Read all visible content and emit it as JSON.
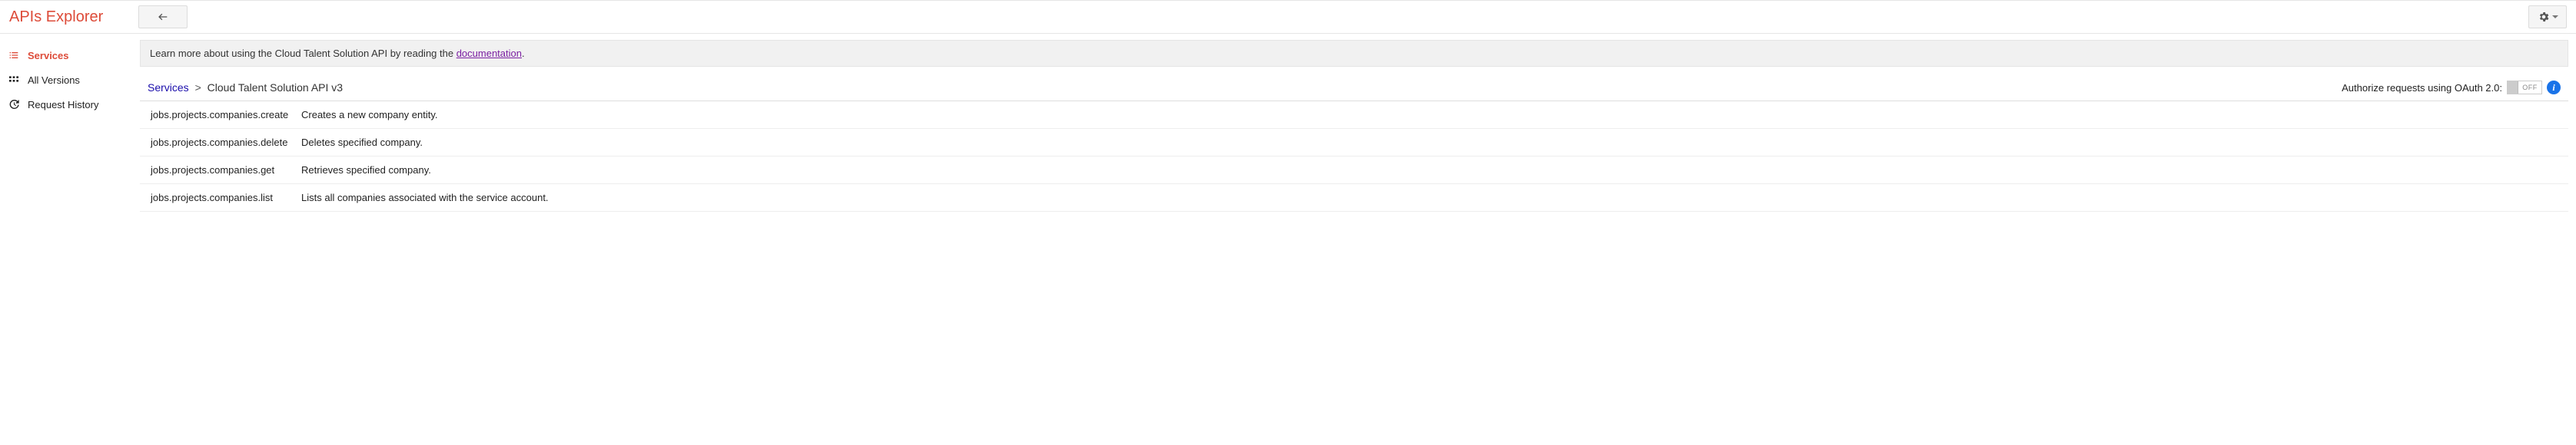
{
  "header": {
    "brand": "APIs Explorer"
  },
  "sidebar": {
    "items": [
      {
        "label": "Services"
      },
      {
        "label": "All Versions"
      },
      {
        "label": "Request History"
      }
    ]
  },
  "banner": {
    "prefix": "Learn more about using the Cloud Talent Solution API by reading the ",
    "link": "documentation",
    "suffix": "."
  },
  "breadcrumb": {
    "root": "Services",
    "sep": ">",
    "current": "Cloud Talent Solution API v3"
  },
  "auth": {
    "label": "Authorize requests using OAuth 2.0:",
    "toggle": "OFF"
  },
  "methods": [
    {
      "name": "jobs.projects.companies.create",
      "desc": "Creates a new company entity."
    },
    {
      "name": "jobs.projects.companies.delete",
      "desc": "Deletes specified company."
    },
    {
      "name": "jobs.projects.companies.get",
      "desc": "Retrieves specified company."
    },
    {
      "name": "jobs.projects.companies.list",
      "desc": "Lists all companies associated with the service account."
    }
  ]
}
